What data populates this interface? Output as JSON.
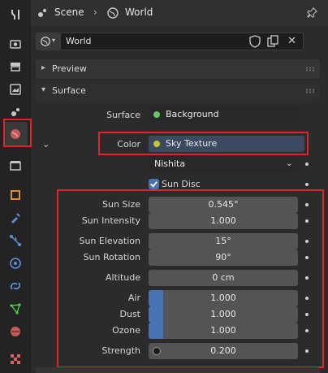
{
  "header": {
    "breadcrumb": [
      "Scene",
      "World"
    ],
    "pin_icon": "pin-icon"
  },
  "world_selector": {
    "value": "World"
  },
  "panels": {
    "preview": "Preview",
    "surface": "Surface"
  },
  "surface_rows": {
    "surface_label": "Surface",
    "surface_value": "Background",
    "color_label": "Color",
    "color_value": "Sky Texture",
    "sky_type": "Nishita",
    "sun_disc_label": "Sun Disc",
    "sun_disc_checked": true
  },
  "params": [
    {
      "label": "Sun Size",
      "value": "0.545°"
    },
    {
      "label": "Sun Intensity",
      "value": "1.000"
    },
    {
      "label": "Sun Elevation",
      "value": "15°"
    },
    {
      "label": "Sun Rotation",
      "value": "90°"
    },
    {
      "label": "Altitude",
      "value": "0 cm"
    },
    {
      "label": "Air",
      "value": "1.000",
      "fill": 0.1
    },
    {
      "label": "Dust",
      "value": "1.000",
      "fill": 0.1
    },
    {
      "label": "Ozone",
      "value": "1.000",
      "fill": 0.1
    },
    {
      "label": "Strength",
      "value": "0.200"
    }
  ],
  "colors": {
    "accent_blue": "#4772b3",
    "highlight_red": "#e0232c",
    "socket_green": "#63c763",
    "socket_yellow": "#c7c729",
    "sky_texture_field": "#3a4a63"
  }
}
